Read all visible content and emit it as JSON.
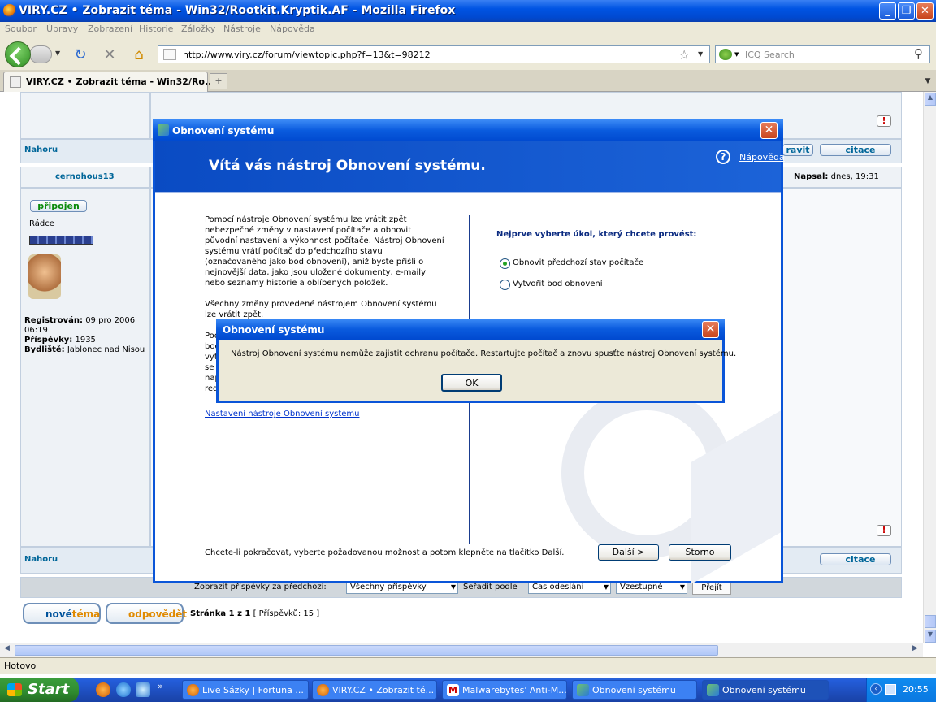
{
  "window": {
    "title": "VIRY.CZ • Zobrazit téma - Win32/Rootkit.Kryptik.AF - Mozilla Firefox",
    "min": "_",
    "max": "❐",
    "close": "✕"
  },
  "menu": [
    "Soubor",
    "Úpravy",
    "Zobrazení",
    "Historie",
    "Záložky",
    "Nástroje",
    "Nápověda"
  ],
  "nav": {
    "url": "http://www.viry.cz/forum/viewtopic.php?f=13&t=98212",
    "search_placeholder": "ICQ Search"
  },
  "tab": {
    "title": "VIRY.CZ • Zobrazit téma - Win32/Ro...",
    "new_tab": "+"
  },
  "forum": {
    "nahoru": "Nahoru",
    "upravit": "ravit",
    "citace": "citace",
    "author": "cernohous13",
    "connected": "připojen",
    "rank": "Rádce",
    "registered_label": "Registrován:",
    "registered_value": "09 pro 2006 06:19",
    "posts_label": "Příspěvky:",
    "posts_value": "1935",
    "location_label": "Bydliště:",
    "location_value": "Jablonec nad Nisou",
    "wrote_label": "Napsal:",
    "wrote_value": "dnes, 19:31",
    "filter_label": "Zobrazit příspěvky za předchozí:",
    "filter_value": "Všechny příspěvky",
    "sort_label": "Seřadit podle",
    "sort_value": "Čas odeslání",
    "order_value": "Vzestupně",
    "go_label": "Přejít",
    "new_topic_1": "nové",
    "new_topic_2": "téma",
    "reply": "odpovědět",
    "page_label": "Stránka 1 z 1",
    "count_label": "[ Příspěvků: 15 ]"
  },
  "dialog": {
    "title": "Obnovení systému",
    "heading": "Vítá vás nástroj Obnovení systému.",
    "help": "Nápověda",
    "para1": "Pomocí nástroje Obnovení systému lze vrátit zpět nebezpečné změny v nastavení počítače a obnovit původní nastavení a výkonnost počítače. Nástroj Obnovení systému vrátí počítač do předchozího stavu (označovaného jako bod obnovení), aniž byste přišli o nejnovější data, jako jsou uložené dokumenty, e-maily nebo seznamy historie a oblíbených položek.",
    "para2": "Všechny změny provedené nástrojem Obnovení systému lze vrátit zpět.",
    "para3_lines": [
      "Poc",
      "bod",
      "vyt",
      "se",
      "nap",
      "reg"
    ],
    "settings_link": "Nastavení nástroje Obnovení systému",
    "task_prompt": "Nejprve vyberte úkol, který chcete provést:",
    "option1": "Obnovit předchozí stav počítače",
    "option2": "Vytvořit bod obnovení",
    "footer": "Chcete-li pokračovat, vyberte požadovanou možnost a potom klepněte na tlačítko Další.",
    "next": "Další >",
    "cancel": "Storno"
  },
  "error": {
    "title": "Obnovení systému",
    "message": "Nástroj Obnovení systému nemůže zajistit ochranu počítače. Restartujte počítač a znovu spusťte nástroj Obnovení systému.",
    "ok": "OK"
  },
  "status": "Hotovo",
  "taskbar": {
    "start": "Start",
    "tasks": [
      "Live Sázky | Fortuna ...",
      "VIRY.CZ • Zobrazit té...",
      "Malwarebytes' Anti-M...",
      "Obnovení systému",
      "Obnovení systému"
    ],
    "clock": "20:55"
  }
}
